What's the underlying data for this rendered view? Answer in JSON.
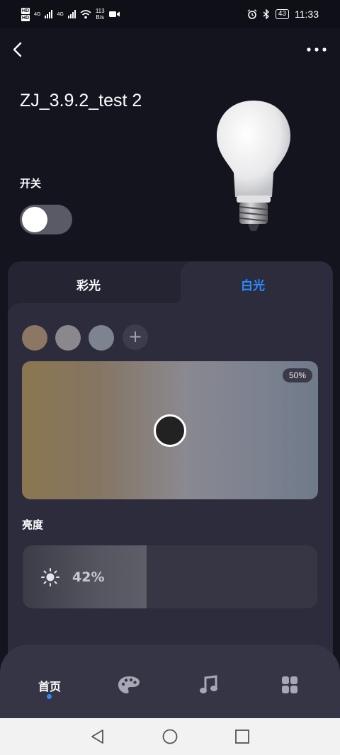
{
  "status_bar": {
    "network_speed": "113",
    "network_unit": "B/s",
    "battery": "43",
    "time": "11:33",
    "hd_badge": "HD",
    "cell_type": "4G"
  },
  "header": {
    "back_icon": "chevron-left-icon",
    "more_icon": "more-dots-icon"
  },
  "device": {
    "name": "ZJ_3.9.2_test 2",
    "image": "light-bulb-image"
  },
  "power": {
    "label": "开关",
    "on": false
  },
  "tabs": [
    {
      "label": "彩光",
      "active": false
    },
    {
      "label": "白光",
      "active": true
    }
  ],
  "presets": {
    "colors": [
      "#8b7763",
      "#8a888c",
      "#7e8390"
    ],
    "add_icon": "plus-icon"
  },
  "temperature": {
    "percent_label": "50%",
    "value": 0.5
  },
  "brightness": {
    "label": "亮度",
    "value_label": "42%",
    "value": 0.42,
    "icon": "sun-icon"
  },
  "bottom_nav": {
    "items": [
      {
        "label": "首页",
        "icon": "home",
        "active": true
      },
      {
        "label": "",
        "icon": "palette-icon",
        "active": false
      },
      {
        "label": "",
        "icon": "music-icon",
        "active": false
      },
      {
        "label": "",
        "icon": "scenes-icon",
        "active": false
      }
    ]
  },
  "colors": {
    "accent": "#2a8cff",
    "background": "#14141f",
    "panel": "#2c2c3c"
  }
}
